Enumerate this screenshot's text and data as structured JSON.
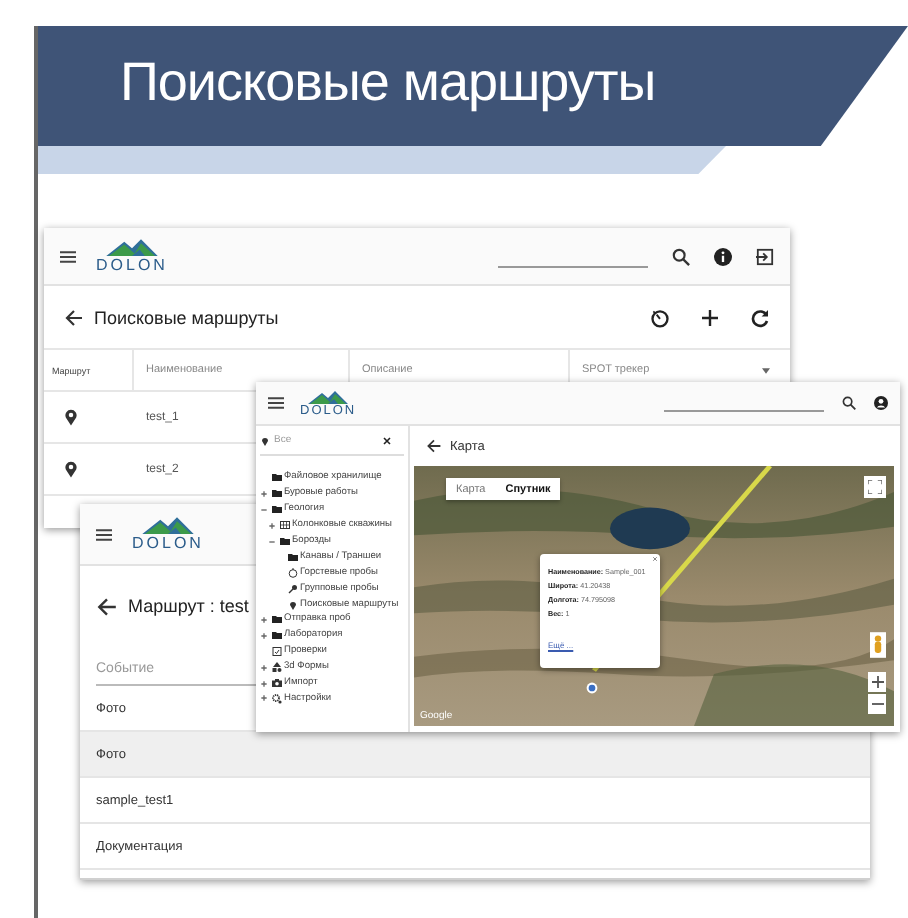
{
  "slide": {
    "title": "Поисковые маршруты"
  },
  "routes_window": {
    "logo": "DOLON",
    "title": "Поисковые маршруты",
    "columns": [
      "Маршрут",
      "Наименование",
      "Описание",
      "SPOT трекер"
    ],
    "rows": [
      {
        "name": "test_1"
      },
      {
        "name": "test_2"
      }
    ]
  },
  "map_window": {
    "logo": "DOLON",
    "search_placeholder": "Все",
    "tree": [
      {
        "label": "Файловое хранилище",
        "kind": "folder"
      },
      {
        "label": "Буровые работы",
        "kind": "folder",
        "expanded": false
      },
      {
        "label": "Геология",
        "kind": "folder",
        "expanded": true,
        "children": [
          {
            "label": "Колонковые скважины",
            "kind": "table",
            "expanded": false
          },
          {
            "label": "Борозды",
            "kind": "folder",
            "expanded": true,
            "children": [
              {
                "label": "Канавы / Траншеи",
                "kind": "folder"
              },
              {
                "label": "Горстевые пробы",
                "kind": "sample"
              },
              {
                "label": "Групповые пробы",
                "kind": "group"
              },
              {
                "label": "Поисковые маршруты",
                "kind": "route"
              }
            ]
          }
        ]
      },
      {
        "label": "Отправка проб",
        "kind": "folder",
        "expanded": false
      },
      {
        "label": "Лаборатория",
        "kind": "folder",
        "expanded": false
      },
      {
        "label": "Проверки",
        "kind": "check"
      },
      {
        "label": "3d Формы",
        "kind": "shapes",
        "expanded": false
      },
      {
        "label": "Импорт",
        "kind": "import",
        "expanded": false
      },
      {
        "label": "Настройки",
        "kind": "settings",
        "expanded": false
      }
    ],
    "title": "Карта",
    "map_types": [
      {
        "label": "Карта",
        "selected": false
      },
      {
        "label": "Спутник",
        "selected": true
      }
    ],
    "popup": {
      "lines": [
        "**Наименование:** Sample_001",
        "**Широта:** 41.20438",
        "**Долгота:** 74.795098",
        "**Вес:** 1"
      ],
      "link": "Ещё ..."
    },
    "attribution": "Google"
  },
  "route_window": {
    "logo": "DOLON",
    "title": "Маршрут : test",
    "filter_placeholder": "Событие",
    "rows": [
      {
        "label": "Фото",
        "selected": false
      },
      {
        "label": "Фото",
        "selected": true
      },
      {
        "label": "sample_test1",
        "selected": false
      },
      {
        "label": "Документация",
        "selected": false
      }
    ]
  }
}
